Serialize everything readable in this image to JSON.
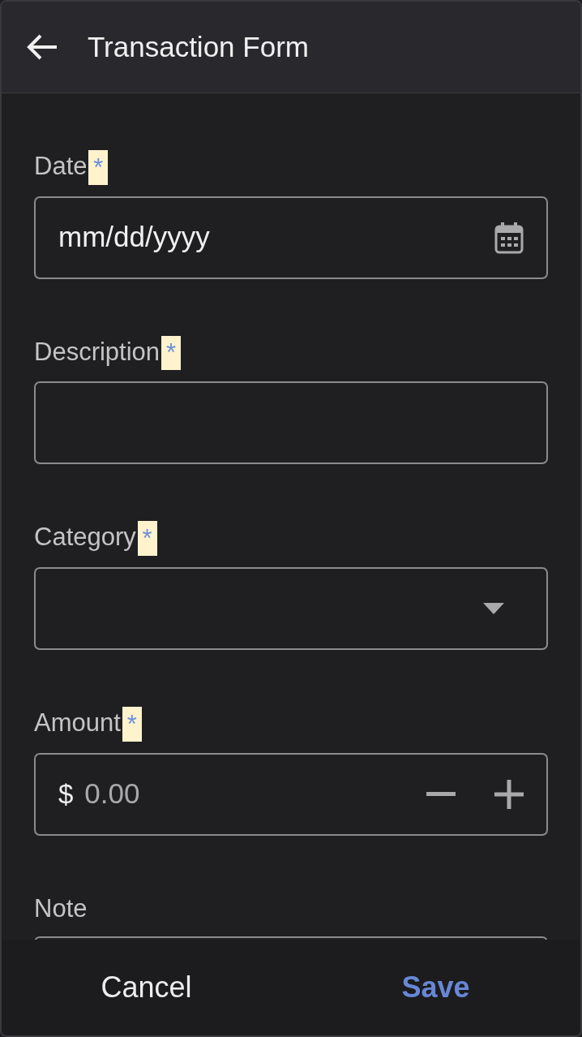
{
  "header": {
    "title": "Transaction Form"
  },
  "fields": [
    {
      "kind": "date",
      "label": "Date",
      "marker": "*",
      "placeholder": "mm/dd/yyyy"
    },
    {
      "kind": "text",
      "label": "Description",
      "marker": "*"
    },
    {
      "kind": "select",
      "label": "Category",
      "marker": "*"
    },
    {
      "kind": "amount",
      "label": "Amount",
      "marker": "*",
      "prefix": "$",
      "placeholder": "0.00"
    },
    {
      "kind": "text",
      "label": "Note"
    }
  ],
  "footer": {
    "buttons": [
      {
        "label": "Cancel",
        "primary": false
      },
      {
        "label": "Save",
        "primary": true
      }
    ]
  }
}
